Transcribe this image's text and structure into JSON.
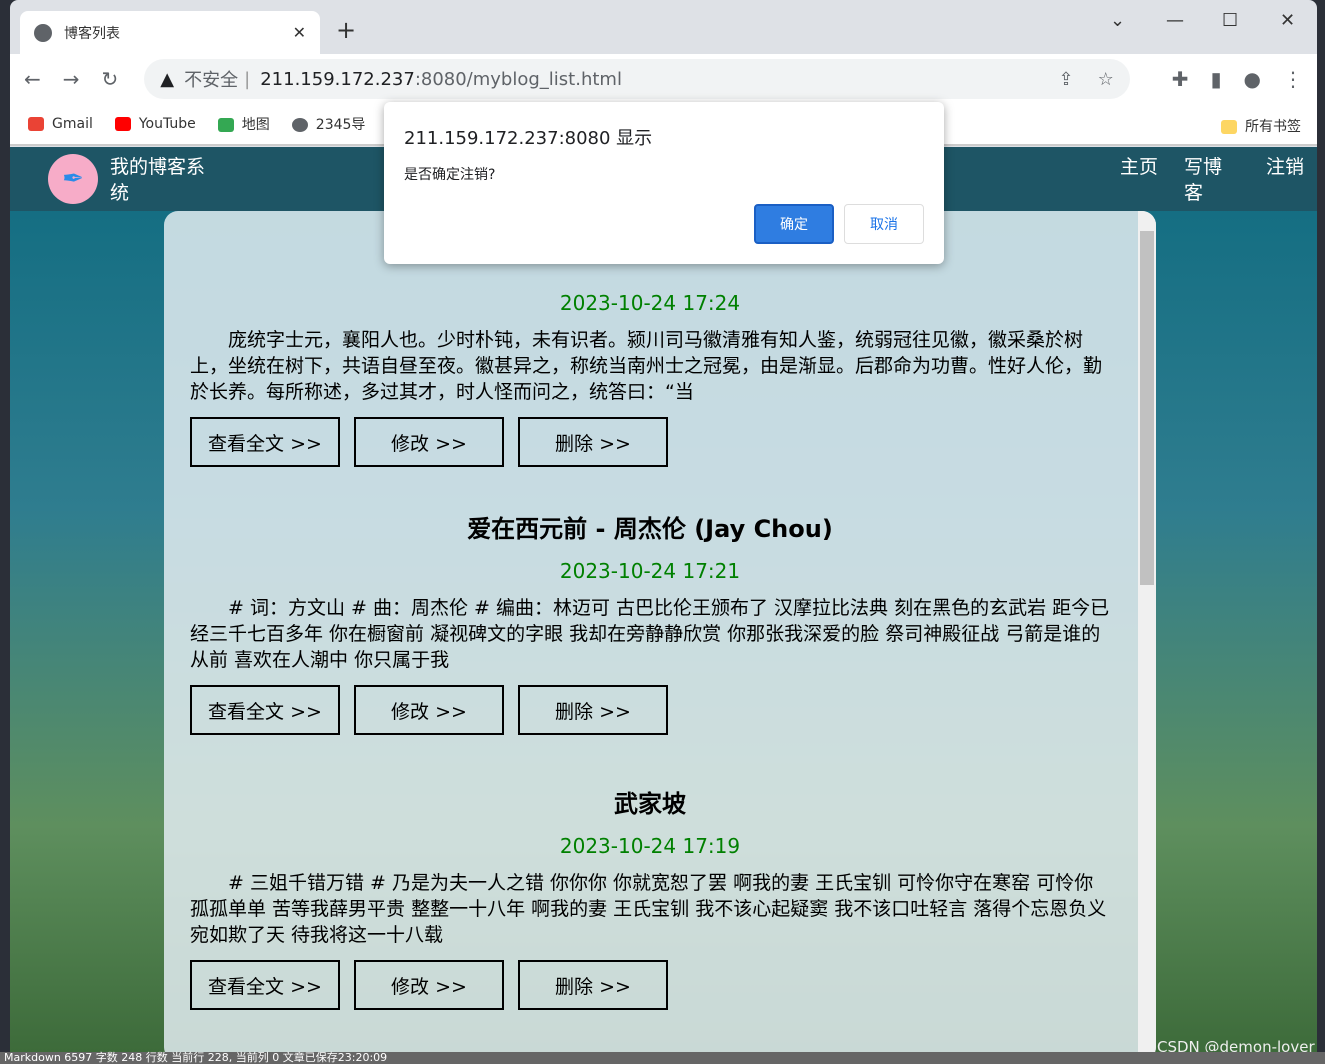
{
  "browser": {
    "tab_title": "博客列表",
    "url_warning": "不安全",
    "url_host": "211.159.172.237",
    "url_path": ":8080/myblog_list.html",
    "bookmarks": [
      "Gmail",
      "YouTube",
      "地图",
      "2345导"
    ],
    "all_bookmarks": "所有书签"
  },
  "nav": {
    "brand": "我的博客系统",
    "links": [
      "主页",
      "写博客",
      "注销"
    ]
  },
  "posts": [
    {
      "title": "",
      "date": "2023-10-24 17:24",
      "summary": "庞统字士元，襄阳人也。少时朴钝，未有识者。颍川司马徽清雅有知人鉴，统弱冠往见徽，徽采桑於树上，坐统在树下，共语自昼至夜。徽甚异之，称统当南州士之冠冕，由是渐显。后郡命为功曹。性好人伦，勤於长养。每所称述，多过其才，时人怪而问之，统答曰：“当"
    },
    {
      "title": "爱在西元前 - 周杰伦 (Jay Chou)",
      "date": "2023-10-24 17:21",
      "summary": "# 词：方文山 # 曲：周杰伦 # 编曲：林迈可 古巴比伦王颁布了 汉摩拉比法典 刻在黑色的玄武岩 距今已经三千七百多年 你在橱窗前 凝视碑文的字眼 我却在旁静静欣赏 你那张我深爱的脸 祭司神殿征战 弓箭是谁的从前 喜欢在人潮中 你只属于我"
    },
    {
      "title": "武家坡",
      "date": "2023-10-24 17:19",
      "summary": "# 三姐千错万错 # 乃是为夫一人之错 你你你 你就宽恕了罢 啊我的妻 王氏宝钏 可怜你守在寒窑 可怜你孤孤单单 苦等我薛男平贵 整整一十八年 啊我的妻 王氏宝钏 我不该心起疑窦 我不该口吐轻言 落得个忘恩负义 宛如欺了天 待我将这一十八载"
    }
  ],
  "buttons": {
    "view": "查看全文 >>",
    "edit": "修改 >>",
    "delete": "删除 >>"
  },
  "dialog": {
    "title": "211.159.172.237:8080 显示",
    "message": "是否确定注销?",
    "ok": "确定",
    "cancel": "取消"
  },
  "status_bar": "Markdown  6597 字数  248 行数  当前行 228, 当前列 0  文章已保存23:20:09",
  "watermark": "CSDN @demon-lover"
}
